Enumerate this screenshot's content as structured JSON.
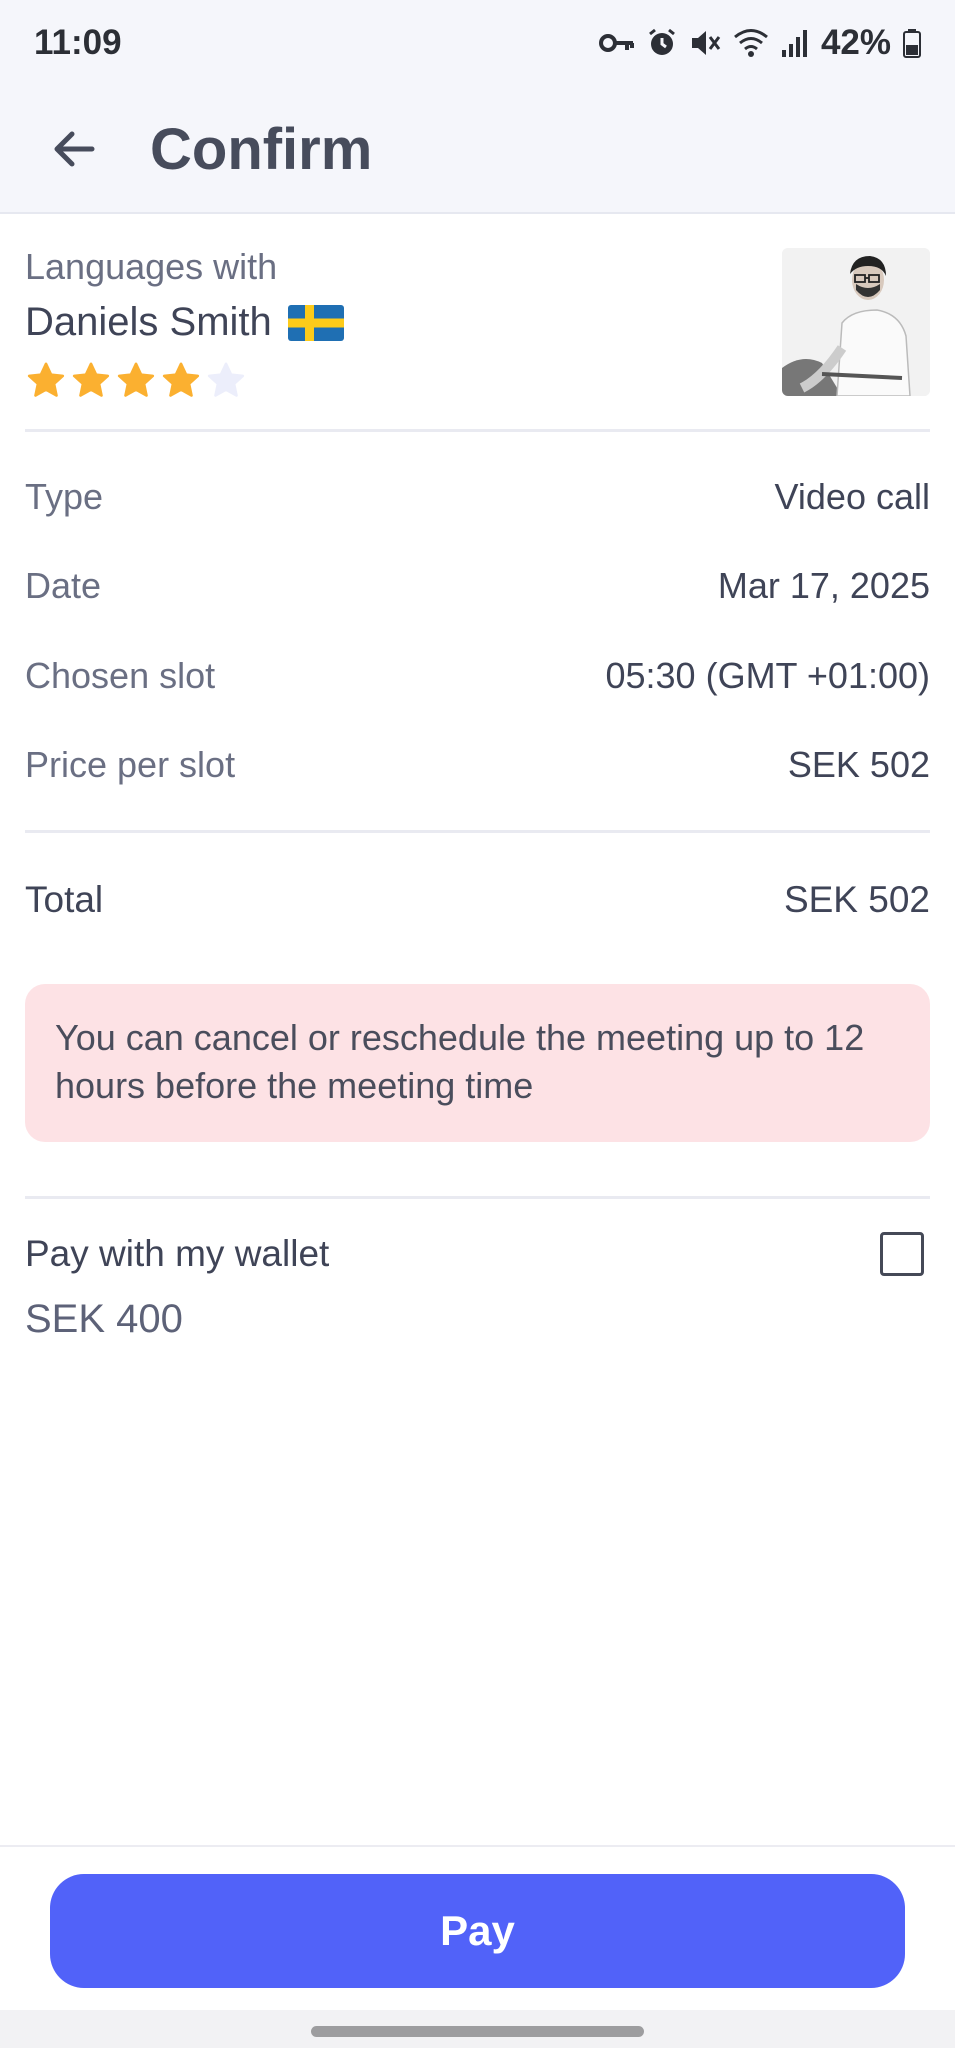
{
  "status_bar": {
    "time": "11:09",
    "battery": "42%"
  },
  "header": {
    "title": "Confirm",
    "back_icon": "arrow-left-icon"
  },
  "tutor": {
    "subtitle": "Languages with",
    "name": "Daniels Smith",
    "flag": "sweden-flag",
    "rating": 4,
    "rating_max": 5
  },
  "details": [
    {
      "label": "Type",
      "value": "Video call"
    },
    {
      "label": "Date",
      "value": "Mar 17, 2025"
    },
    {
      "label": "Chosen slot",
      "value": "05:30 (GMT +01:00)"
    },
    {
      "label": "Price per slot",
      "value": "SEK 502"
    }
  ],
  "total": {
    "label": "Total",
    "value": "SEK 502"
  },
  "notice": "You can cancel or reschedule the meeting up to 12 hours before the meeting time",
  "wallet": {
    "label": "Pay with my wallet",
    "amount": "SEK 400",
    "checked": false
  },
  "pay_button": "Pay",
  "colors": {
    "primary": "#5162F9",
    "notice_bg": "#FDE2E5",
    "star": "#FBB030",
    "star_empty": "#ECEEFB"
  }
}
